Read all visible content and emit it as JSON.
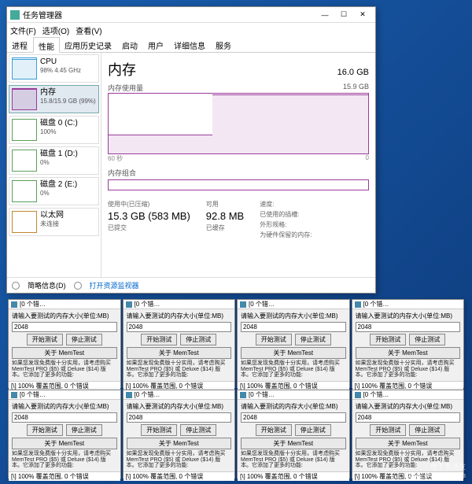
{
  "taskmgr": {
    "title": "任务管理器",
    "menu": [
      "文件(F)",
      "选项(O)",
      "查看(V)"
    ],
    "tabs": [
      "进程",
      "性能",
      "应用历史记录",
      "启动",
      "用户",
      "详细信息",
      "服务"
    ],
    "active_tab": 1,
    "sidebar": [
      {
        "type": "cpu",
        "title": "CPU",
        "sub": "98%  4.45 GHz"
      },
      {
        "type": "mem",
        "title": "内存",
        "sub": "15.8/15.9 GB (99%)",
        "selected": true
      },
      {
        "type": "disk",
        "title": "磁盘 0 (C:)",
        "sub": "100%"
      },
      {
        "type": "disk",
        "title": "磁盘 1 (D:)",
        "sub": "0%"
      },
      {
        "type": "disk",
        "title": "磁盘 2 (E:)",
        "sub": "0%"
      },
      {
        "type": "net",
        "title": "以太网",
        "sub": "未连接"
      }
    ],
    "main": {
      "title": "内存",
      "total": "16.0 GB",
      "usage_label": "内存使用量",
      "usage_max": "15.9 GB",
      "axis_left": "60 秒",
      "axis_right": "0",
      "comp_label": "内存组合",
      "stats": {
        "used_label": "使用中(已压缩)",
        "used_val": "15.3 GB (583 MB)",
        "avail_label": "可用",
        "avail_val": "92.8 MB",
        "committed_label": "已提交",
        "committed_val": "",
        "cached_label": "已缓存",
        "cached_val": "",
        "speed_label": "速度:",
        "slots_label": "已使用的插槽:",
        "form_label": "外形规格:",
        "reserved_label": "为硬件保留的内存:"
      }
    },
    "bottom": {
      "brief": "简略信息(D)",
      "link": "打开资源监视器"
    }
  },
  "memtest": {
    "title": "[0 个错…",
    "prompt": "请输入要测试的内存大小(单位:MB)",
    "value": "2048",
    "start": "开始测试",
    "stop": "停止测试",
    "about": "关于 MemTest",
    "info": "如果您发现免费版十分实用，请考虑购买 MemTest PRO ($5) 或 Deluxe ($14) 版本。它添加了更多的功能:",
    "status": "[\\]  100%  覆盖范围, 0 个错误"
  },
  "watermark": {
    "l1": "电子发烧友",
    "l2": "www.elecfans.com"
  },
  "chart_data": {
    "type": "area",
    "title": "内存使用量",
    "ylabel": "GB",
    "ylim": [
      0,
      15.9
    ],
    "xlim_seconds": [
      60,
      0
    ],
    "series": [
      {
        "name": "内存",
        "color": "#9b3b9b",
        "values_gb": [
          5.0,
          5.0,
          5.0,
          5.0,
          5.0,
          15.8,
          15.8,
          15.8,
          15.8,
          15.8,
          15.8
        ],
        "x_fraction": [
          0.0,
          0.1,
          0.2,
          0.3,
          0.39,
          0.41,
          0.5,
          0.6,
          0.7,
          0.8,
          1.0
        ]
      }
    ]
  }
}
